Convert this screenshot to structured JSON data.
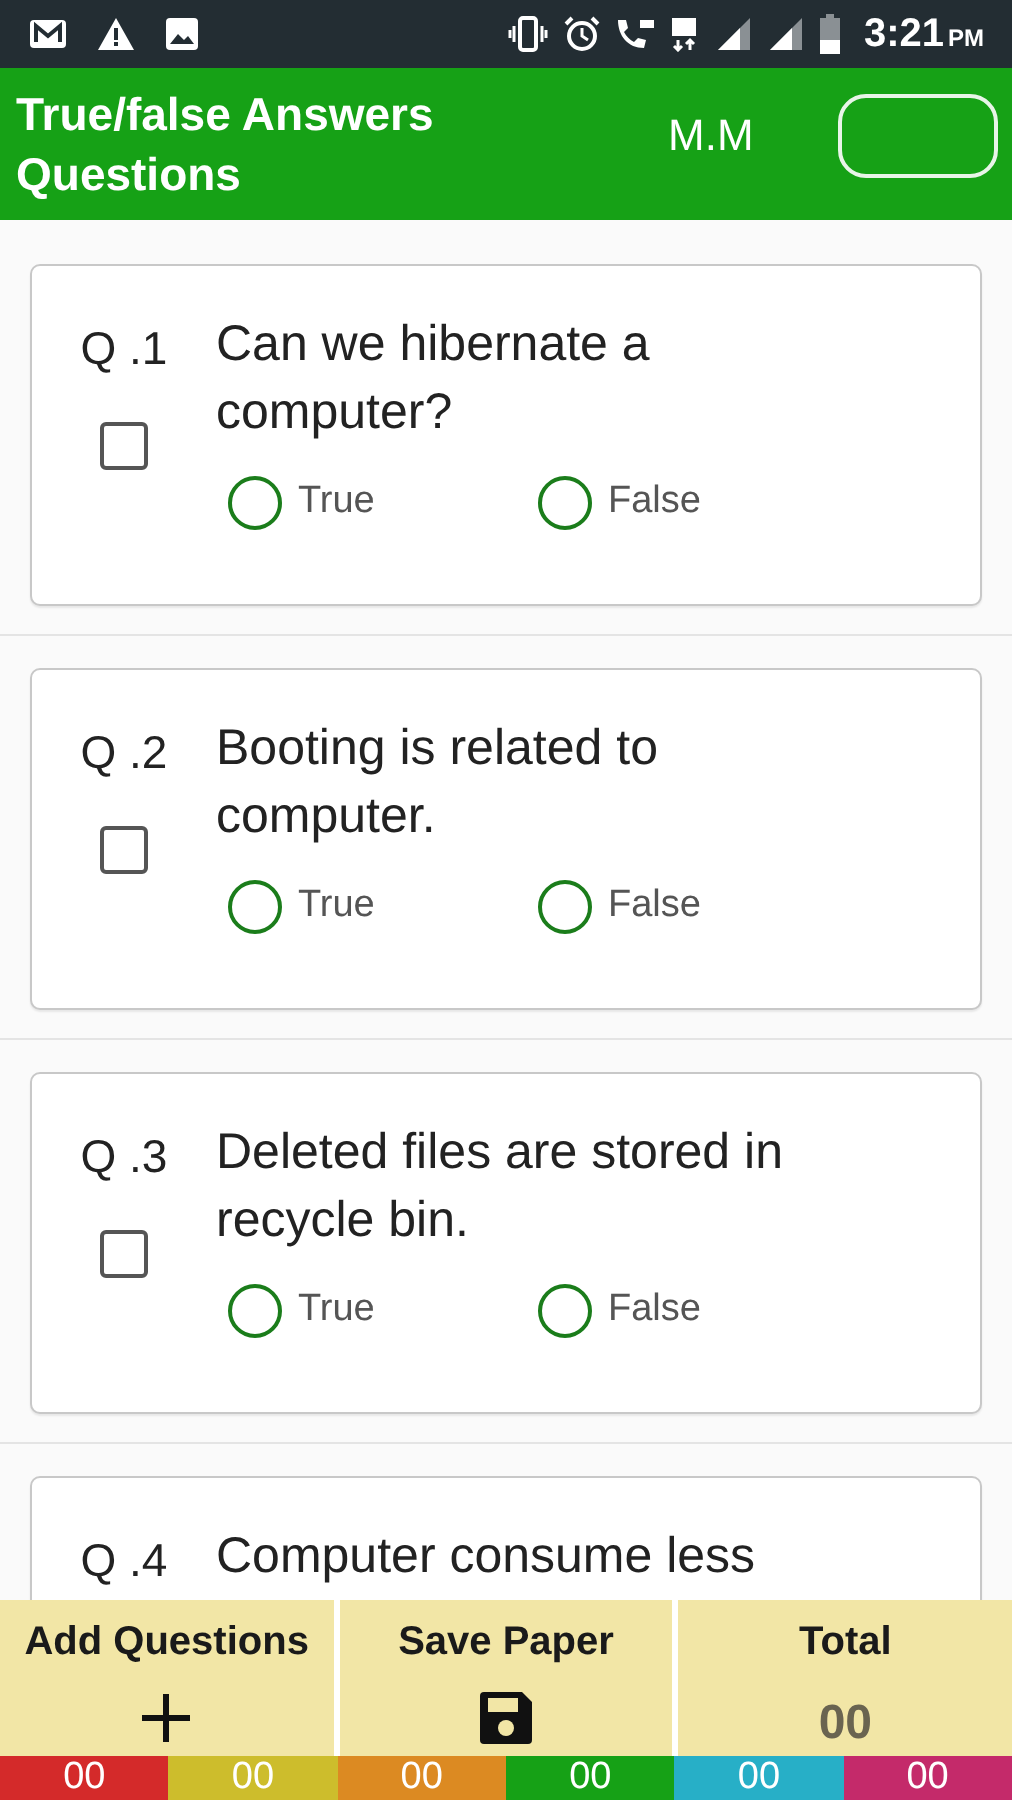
{
  "status_bar": {
    "time": "3:21",
    "meridiem": "PM"
  },
  "header": {
    "title": "True/false Answers Questions",
    "user": "M.M"
  },
  "questions": [
    {
      "number": "Q .1",
      "text": "Can we hibernate a computer?",
      "checked": false,
      "options": [
        {
          "label": "True",
          "selected": false
        },
        {
          "label": "False",
          "selected": false
        }
      ]
    },
    {
      "number": "Q .2",
      "text": "Booting is related to computer.",
      "checked": false,
      "options": [
        {
          "label": "True",
          "selected": false
        },
        {
          "label": "False",
          "selected": false
        }
      ]
    },
    {
      "number": "Q .3",
      "text": "Deleted files are stored in recycle bin.",
      "checked": false,
      "options": [
        {
          "label": "True",
          "selected": false
        },
        {
          "label": "False",
          "selected": false
        }
      ]
    },
    {
      "number": "Q .4",
      "text": "Computer consume less"
    }
  ],
  "bottom_bar": [
    {
      "kind": "add",
      "label": "Add Questions"
    },
    {
      "kind": "save",
      "label": "Save Paper"
    },
    {
      "kind": "total",
      "label": "Total",
      "value": "00"
    }
  ],
  "counters": [
    {
      "value": "00",
      "color": "#d42a2a"
    },
    {
      "value": "00",
      "color": "#cdbd2c"
    },
    {
      "value": "00",
      "color": "#dc8a22"
    },
    {
      "value": "00",
      "color": "#16a116"
    },
    {
      "value": "00",
      "color": "#27afc7"
    },
    {
      "value": "00",
      "color": "#c42a6a"
    }
  ]
}
